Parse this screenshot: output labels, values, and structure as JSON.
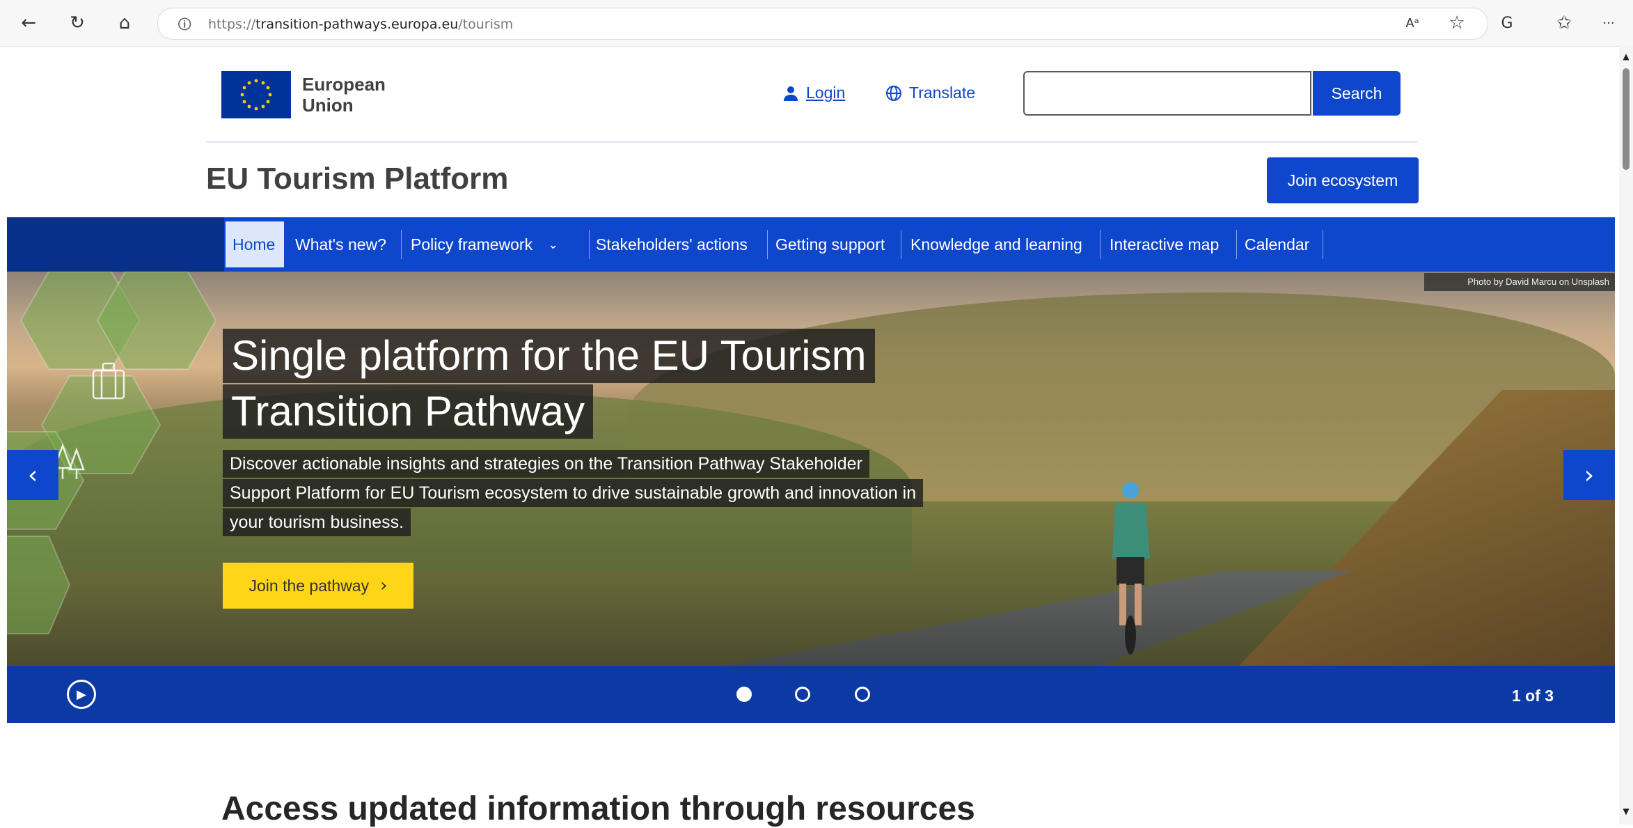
{
  "browser": {
    "url_scheme": "https://",
    "url_host": "transition-pathways.europa.eu",
    "url_path": "/tourism",
    "back_icon": "←",
    "refresh_icon": "↻",
    "home_icon": "⌂",
    "read_aloud_icon": "Aᵃ",
    "favorite_icon": "☆",
    "copilot_icon": "G",
    "collections_icon": "✩",
    "more_icon": "···"
  },
  "header": {
    "eu_label": "European Union",
    "login_label": "Login",
    "translate_label": "Translate",
    "search_placeholder": "",
    "search_button": "Search",
    "site_title": "EU Tourism Platform",
    "join_ecosystem": "Join ecosystem"
  },
  "nav": {
    "items": [
      {
        "label": "Home"
      },
      {
        "label": "What's new?"
      },
      {
        "label": "Policy framework"
      },
      {
        "label": "Stakeholders' actions"
      },
      {
        "label": "Getting support"
      },
      {
        "label": "Knowledge and learning"
      },
      {
        "label": "Interactive map"
      },
      {
        "label": "Calendar"
      }
    ]
  },
  "hero": {
    "photo_credit": "Photo by David Marcu on Unsplash",
    "headline_line1": "Single platform for the EU Tourism",
    "headline_line2": "Transition Pathway",
    "desc_line1": "Discover actionable insights and strategies on the Transition Pathway Stakeholder",
    "desc_line2": "Support Platform for EU Tourism ecosystem to drive sustainable growth and innovation in",
    "desc_line3": "your tourism business.",
    "cta_label": "Join the pathway",
    "prev_icon": "‹",
    "next_icon": "›"
  },
  "carousel": {
    "counter": "1 of 3",
    "active_slide": 1,
    "total_slides": 3
  },
  "main": {
    "section_heading": "Access updated information through resources"
  },
  "colors": {
    "primary": "#0e47cb",
    "dark_blue": "#082f8a",
    "accent_yellow": "#ffd617",
    "eu_flag": "#003399",
    "eu_star": "#ffcc00"
  }
}
